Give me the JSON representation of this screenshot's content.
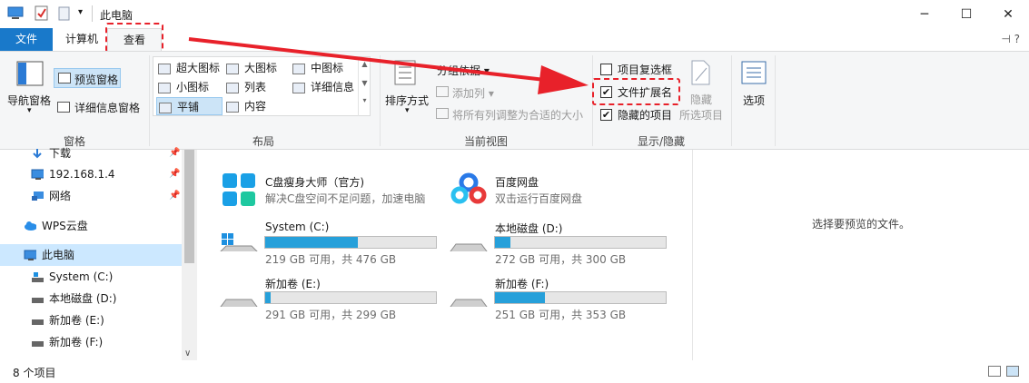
{
  "window": {
    "title": "此电脑",
    "buttons": {
      "minimize": "─",
      "maximize": "☐",
      "close": "✕"
    }
  },
  "tabs": [
    {
      "label": "文件"
    },
    {
      "label": "计算机"
    },
    {
      "label": "查看"
    }
  ],
  "ribbon": {
    "pane_group": {
      "nav_pane": "导航窗格",
      "preview_pane": "预览窗格",
      "details_pane": "详细信息窗格",
      "label": "窗格"
    },
    "layout_group": {
      "items": [
        "超大图标",
        "大图标",
        "中图标",
        "小图标",
        "列表",
        "详细信息",
        "平铺",
        "内容"
      ],
      "selected": "平铺",
      "label": "布局"
    },
    "current_view_group": {
      "sort_by": "排序方式",
      "group_by": "分组依据",
      "add_columns": "添加列",
      "fit_columns": "将所有列调整为合适的大小",
      "label": "当前视图"
    },
    "show_hide_group": {
      "item_checkboxes": {
        "label": "项目复选框",
        "checked": false
      },
      "file_extensions": {
        "label": "文件扩展名",
        "checked": true
      },
      "hidden_items": {
        "label": "隐藏的项目",
        "checked": true
      },
      "hide": "隐藏",
      "selected_items": "所选项目",
      "label": "显示/隐藏"
    },
    "options": "选项"
  },
  "nav": {
    "items": [
      {
        "label": "下载",
        "pinned": true,
        "icon": "download-icon"
      },
      {
        "label": "192.168.1.4",
        "pinned": true,
        "icon": "monitor-icon"
      },
      {
        "label": "网络",
        "pinned": true,
        "icon": "network-icon"
      },
      {
        "label": "WPS云盘",
        "pinned": false,
        "icon": "cloud-icon"
      },
      {
        "label": "此电脑",
        "pinned": false,
        "icon": "computer-icon"
      },
      {
        "label": "System (C:)",
        "pinned": false,
        "icon": "drive-icon"
      },
      {
        "label": "本地磁盘 (D:)",
        "pinned": false,
        "icon": "drive-icon"
      },
      {
        "label": "新加卷 (E:)",
        "pinned": false,
        "icon": "drive-icon"
      },
      {
        "label": "新加卷 (F:)",
        "pinned": false,
        "icon": "drive-icon"
      }
    ],
    "pin_glyph": "📌"
  },
  "content": {
    "apps": [
      {
        "name": "C盘瘦身大师（官方)",
        "desc": "解决C盘空间不足问题，加速电脑"
      },
      {
        "name": "百度网盘",
        "desc": "双击运行百度网盘"
      }
    ],
    "drives": [
      {
        "name": "System (C:)",
        "usage": "219 GB 可用，共 476 GB",
        "used_fraction": 0.54
      },
      {
        "name": "本地磁盘 (D:)",
        "usage": "272 GB 可用，共 300 GB",
        "used_fraction": 0.09
      },
      {
        "name": "新加卷 (E:)",
        "usage": "291 GB 可用，共 299 GB",
        "used_fraction": 0.03
      },
      {
        "name": "新加卷 (F:)",
        "usage": "251 GB 可用，共 353 GB",
        "used_fraction": 0.29
      }
    ]
  },
  "preview": {
    "message": "选择要预览的文件。"
  },
  "status": {
    "count": "8 个项目"
  },
  "colors": {
    "accent": "#1979ca",
    "bar_fill": "#26a0da",
    "highlight": "#e8212a"
  }
}
